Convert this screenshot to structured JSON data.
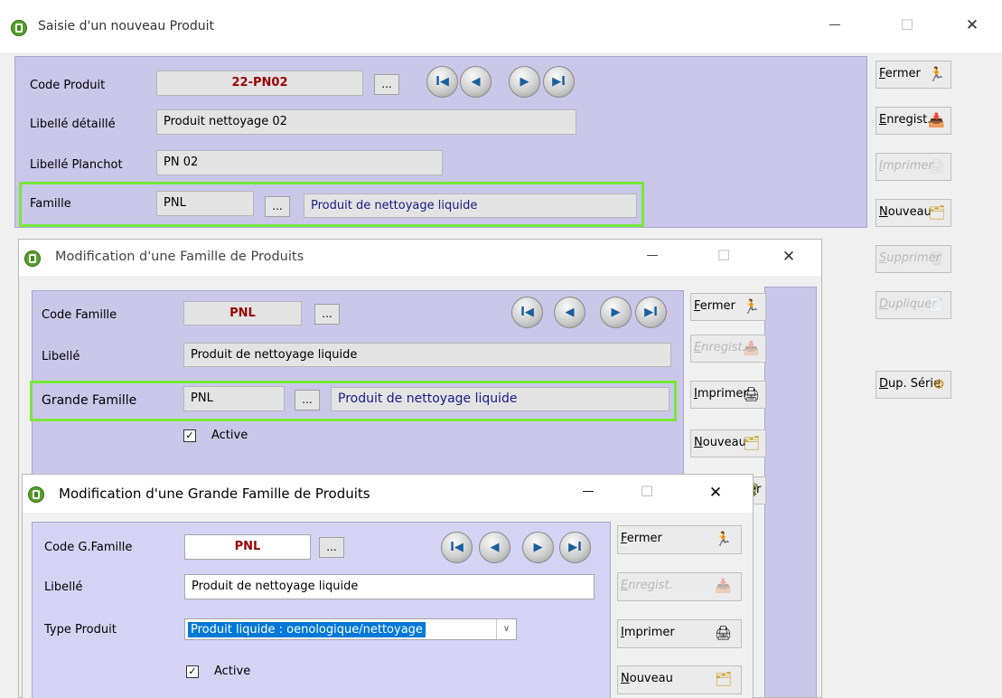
{
  "win1": {
    "title": "Saisie d'un nouveau Produit",
    "labels": {
      "code": "Code Produit",
      "libelle": "Libellé détaillé",
      "planchot": "Libellé Planchot",
      "famille": "Famille"
    },
    "values": {
      "code": "22-PN02",
      "libelle": "Produit nettoyage 02",
      "planchot": "PN 02",
      "famille_code": "PNL",
      "famille_desc": "Produit de nettoyage liquide"
    },
    "buttons": {
      "fermer": "Fermer",
      "enregist": "Enregist.",
      "imprimer": "Imprimer",
      "nouveau": "Nouveau",
      "supprimer": "Supprimer",
      "dupliquer": "Dupliquer",
      "dupserie": "Dup. Série"
    }
  },
  "win2": {
    "title": "Modification d'une Famille de Produits",
    "labels": {
      "code": "Code Famille",
      "libelle": "Libellé",
      "grande": "Grande Famille",
      "active": "Active"
    },
    "values": {
      "code": "PNL",
      "libelle": "Produit de nettoyage liquide",
      "grande_code": "PNL",
      "grande_desc": "Produit de nettoyage liquide"
    },
    "active_checked": true,
    "buttons": {
      "fermer": "Fermer",
      "enregist": "Enregist.",
      "imprimer": "Imprimer",
      "nouveau": "Nouveau",
      "partial": "er"
    }
  },
  "win3": {
    "title": "Modification d'une Grande Famille de Produits",
    "labels": {
      "code": "Code G.Famille",
      "libelle": "Libellé",
      "type": "Type Produit",
      "active": "Active"
    },
    "values": {
      "code": "PNL",
      "libelle": "Produit de nettoyage liquide",
      "type": "Produit liquide : oenologique/nettoyage"
    },
    "active_checked": true,
    "buttons": {
      "fermer": "Fermer",
      "enregist": "Enregist.",
      "imprimer": "Imprimer",
      "nouveau": "Nouveau"
    }
  },
  "common": {
    "ellipsis": "...",
    "minimize": "—",
    "maximize": "☐",
    "close": "✕",
    "check": "✓",
    "nav": {
      "first": "I◀",
      "prev": "◀",
      "next": "▶",
      "last": "▶I"
    }
  },
  "colors": {
    "panel": "#cac7e9",
    "highlight": "#7ae73a",
    "code_text": "#9a0000",
    "selection": "#0078d7"
  }
}
